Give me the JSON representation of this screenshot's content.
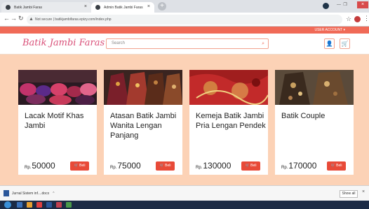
{
  "browser": {
    "tabs": [
      {
        "label": "Batik Jambi Faras"
      },
      {
        "label": "Admin Batik Jambi Faras"
      }
    ],
    "new_tab_glyph": "+",
    "address": {
      "security_label": "Not secure",
      "url": "batikjambifaras.epizy.com/index.php"
    }
  },
  "site": {
    "account_menu": "USER ACCOUNT ▾",
    "logo": "Batik Jambi Faras",
    "search_placeholder": "Search"
  },
  "products": [
    {
      "title": "Lacak Motif Khas Jambi",
      "currency": "Rp.",
      "price": "50000",
      "buy_label": "Beli"
    },
    {
      "title": "Atasan Batik Jambi Wanita Lengan Panjang",
      "currency": "Rp.",
      "price": "75000",
      "buy_label": "Beli"
    },
    {
      "title": "Kemeja Batik Jambi Pria Lengan Pendek",
      "currency": "Rp.",
      "price": "130000",
      "buy_label": "Beli"
    },
    {
      "title": "Batik Couple",
      "currency": "Rp.",
      "price": "170000",
      "buy_label": "Beli"
    }
  ],
  "downloads": {
    "file": "Jurnal Sistem inf....docx",
    "show_all": "Show all"
  },
  "colors": {
    "accent": "#f06a57",
    "page_bg": "#fcd2b6",
    "logo": "#d94f78",
    "buy_button": "#e84a38"
  }
}
